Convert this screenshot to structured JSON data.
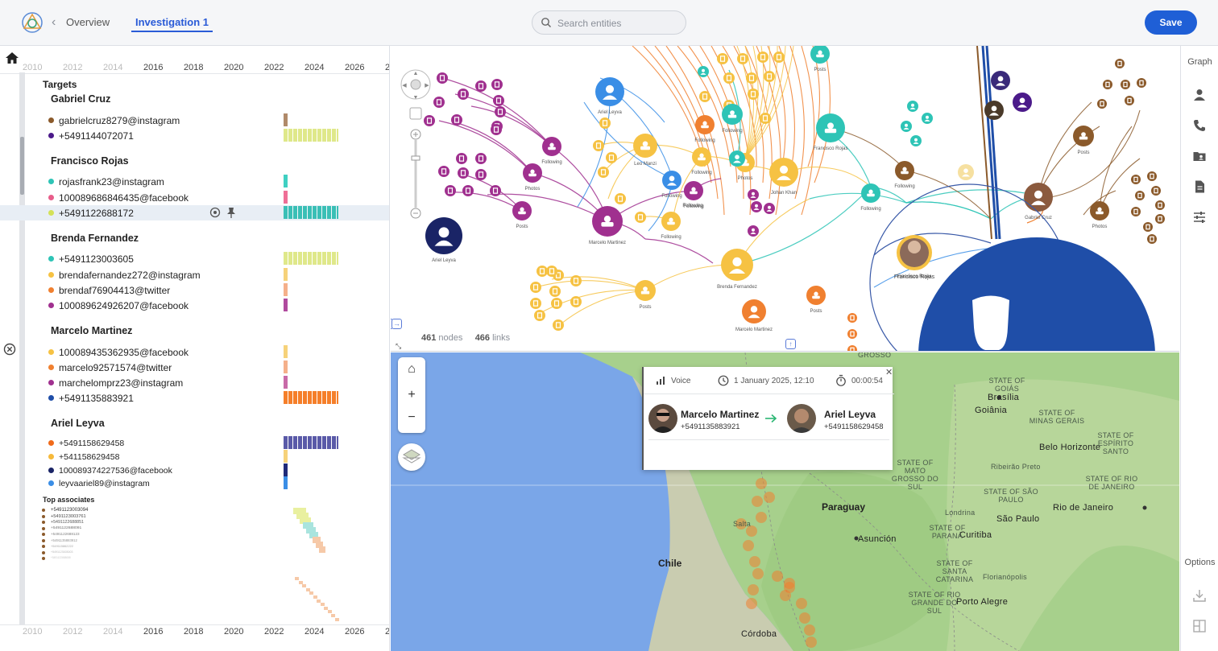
{
  "header": {
    "overview_label": "Overview",
    "investigation_tab": "Investigation 1",
    "search_placeholder": "Search entities",
    "save_label": "Save"
  },
  "timeline": {
    "years": [
      "2010",
      "2012",
      "2014",
      "2016",
      "2018",
      "2020",
      "2022",
      "2024",
      "2026",
      "2"
    ],
    "dim_years": [
      "2010",
      "2012",
      "2014"
    ],
    "targets_title": "Targets",
    "groups": [
      {
        "name": "Gabriel Cruz",
        "items": [
          {
            "label": "gabrielcruz8279@instagram",
            "color": "#8b5a2b"
          },
          {
            "label": "+5491144072071",
            "color": "#4b1a8a"
          }
        ]
      },
      {
        "name": "Francisco Rojas",
        "items": [
          {
            "label": "rojasfrank23@instagram",
            "color": "#2ec4b6"
          },
          {
            "label": "100089686846435@facebook",
            "color": "#e85d8a"
          },
          {
            "label": "+5491122688172",
            "color": "#d4e157",
            "selected": true
          }
        ]
      },
      {
        "name": "Brenda Fernandez",
        "items": [
          {
            "label": "+5491123003605",
            "color": "#2ec4b6"
          },
          {
            "label": "brendafernandez272@instagram",
            "color": "#f6c243"
          },
          {
            "label": "brendaf76904413@twitter",
            "color": "#f08030"
          },
          {
            "label": "100089624926207@facebook",
            "color": "#a0308f"
          }
        ]
      },
      {
        "name": "Marcelo Martinez",
        "items": [
          {
            "label": "100089435362935@facebook",
            "color": "#f6c243"
          },
          {
            "label": "marcelo92571574@twitter",
            "color": "#f08030"
          },
          {
            "label": "marchelomprz23@instagram",
            "color": "#a0308f"
          },
          {
            "label": "+5491135883921",
            "color": "#1f4ea8"
          }
        ]
      },
      {
        "name": "Ariel Leyva",
        "items": [
          {
            "label": "+5491158629458",
            "color": "#f06a1a"
          },
          {
            "label": "+541158629458",
            "color": "#f6b93b"
          },
          {
            "label": "100089374227536@facebook",
            "color": "#1a2466"
          },
          {
            "label": "leyvaariel89@instagram",
            "color": "#3a8ee6"
          }
        ]
      }
    ],
    "top_associates_title": "Top associates",
    "top_associates": [
      "+5491123003094",
      "+5491123003761",
      "+5491122688851",
      "+5491122688091",
      "+5491122688123",
      "+5491135883912",
      "+549115862222",
      "+5491123003003",
      "+5491122688088"
    ]
  },
  "graph": {
    "nodes_count": "461",
    "nodes_label": "nodes",
    "links_count": "466",
    "links_label": "links",
    "node_labels": [
      "Ariel Leyva",
      "Ariel Leyva",
      "Marcelo Martinez",
      "Brenda Fernandez",
      "Francisco Rojas",
      "Francisco Rojas",
      "Gabriel Cruz",
      "Marcelo Martinez",
      "Johan Khan",
      "Leo Manzi",
      "Following",
      "Photos",
      "Posts"
    ]
  },
  "map": {
    "labels": {
      "chile": "Chile",
      "paraguay": "Paraguay",
      "asuncion": "Asunción",
      "brasilia": "Brasília",
      "goiania": "Goiânia",
      "belo": "Belo Horizonte",
      "rio": "Rio de Janeiro",
      "saopaulo": "São Paulo",
      "curitiba": "Curitiba",
      "florianopolis": "Florianópolis",
      "portoalegre": "Porto Alegre",
      "cordoba": "Córdoba",
      "salta": "Salta",
      "londrina": "Londrina",
      "ribeirao": "Ribeirão Preto",
      "mg": "STATE OF MINAS GERAIS",
      "es": "STATE OF ESPÍRITO SANTO",
      "rj": "STATE OF RIO DE JANEIRO",
      "goias": "STATE OF GOIÁS",
      "sp": "STATE OF SÃO PAULO",
      "parana": "STATE OF PARANÁ",
      "sc": "STATE OF SANTA CATARINA",
      "rs": "STATE OF RIO GRANDE DO SUL",
      "ms": "STATE OF MATO GROSSO DO SUL",
      "grosso": "GROSSO"
    },
    "popup": {
      "type": "Voice",
      "date": "1 January 2025, 12:10",
      "duration": "00:00:54",
      "from_name": "Marcelo Martinez",
      "from_number": "+5491135883921",
      "to_name": "Ariel Leyva",
      "to_number": "+5491158629458"
    }
  },
  "right_toolbar": {
    "graph_label": "Graph",
    "options_label": "Options"
  },
  "colors": {
    "accent": "#1f5fd6",
    "map_water": "#7aa6e8",
    "map_land": "#a7d08c"
  }
}
